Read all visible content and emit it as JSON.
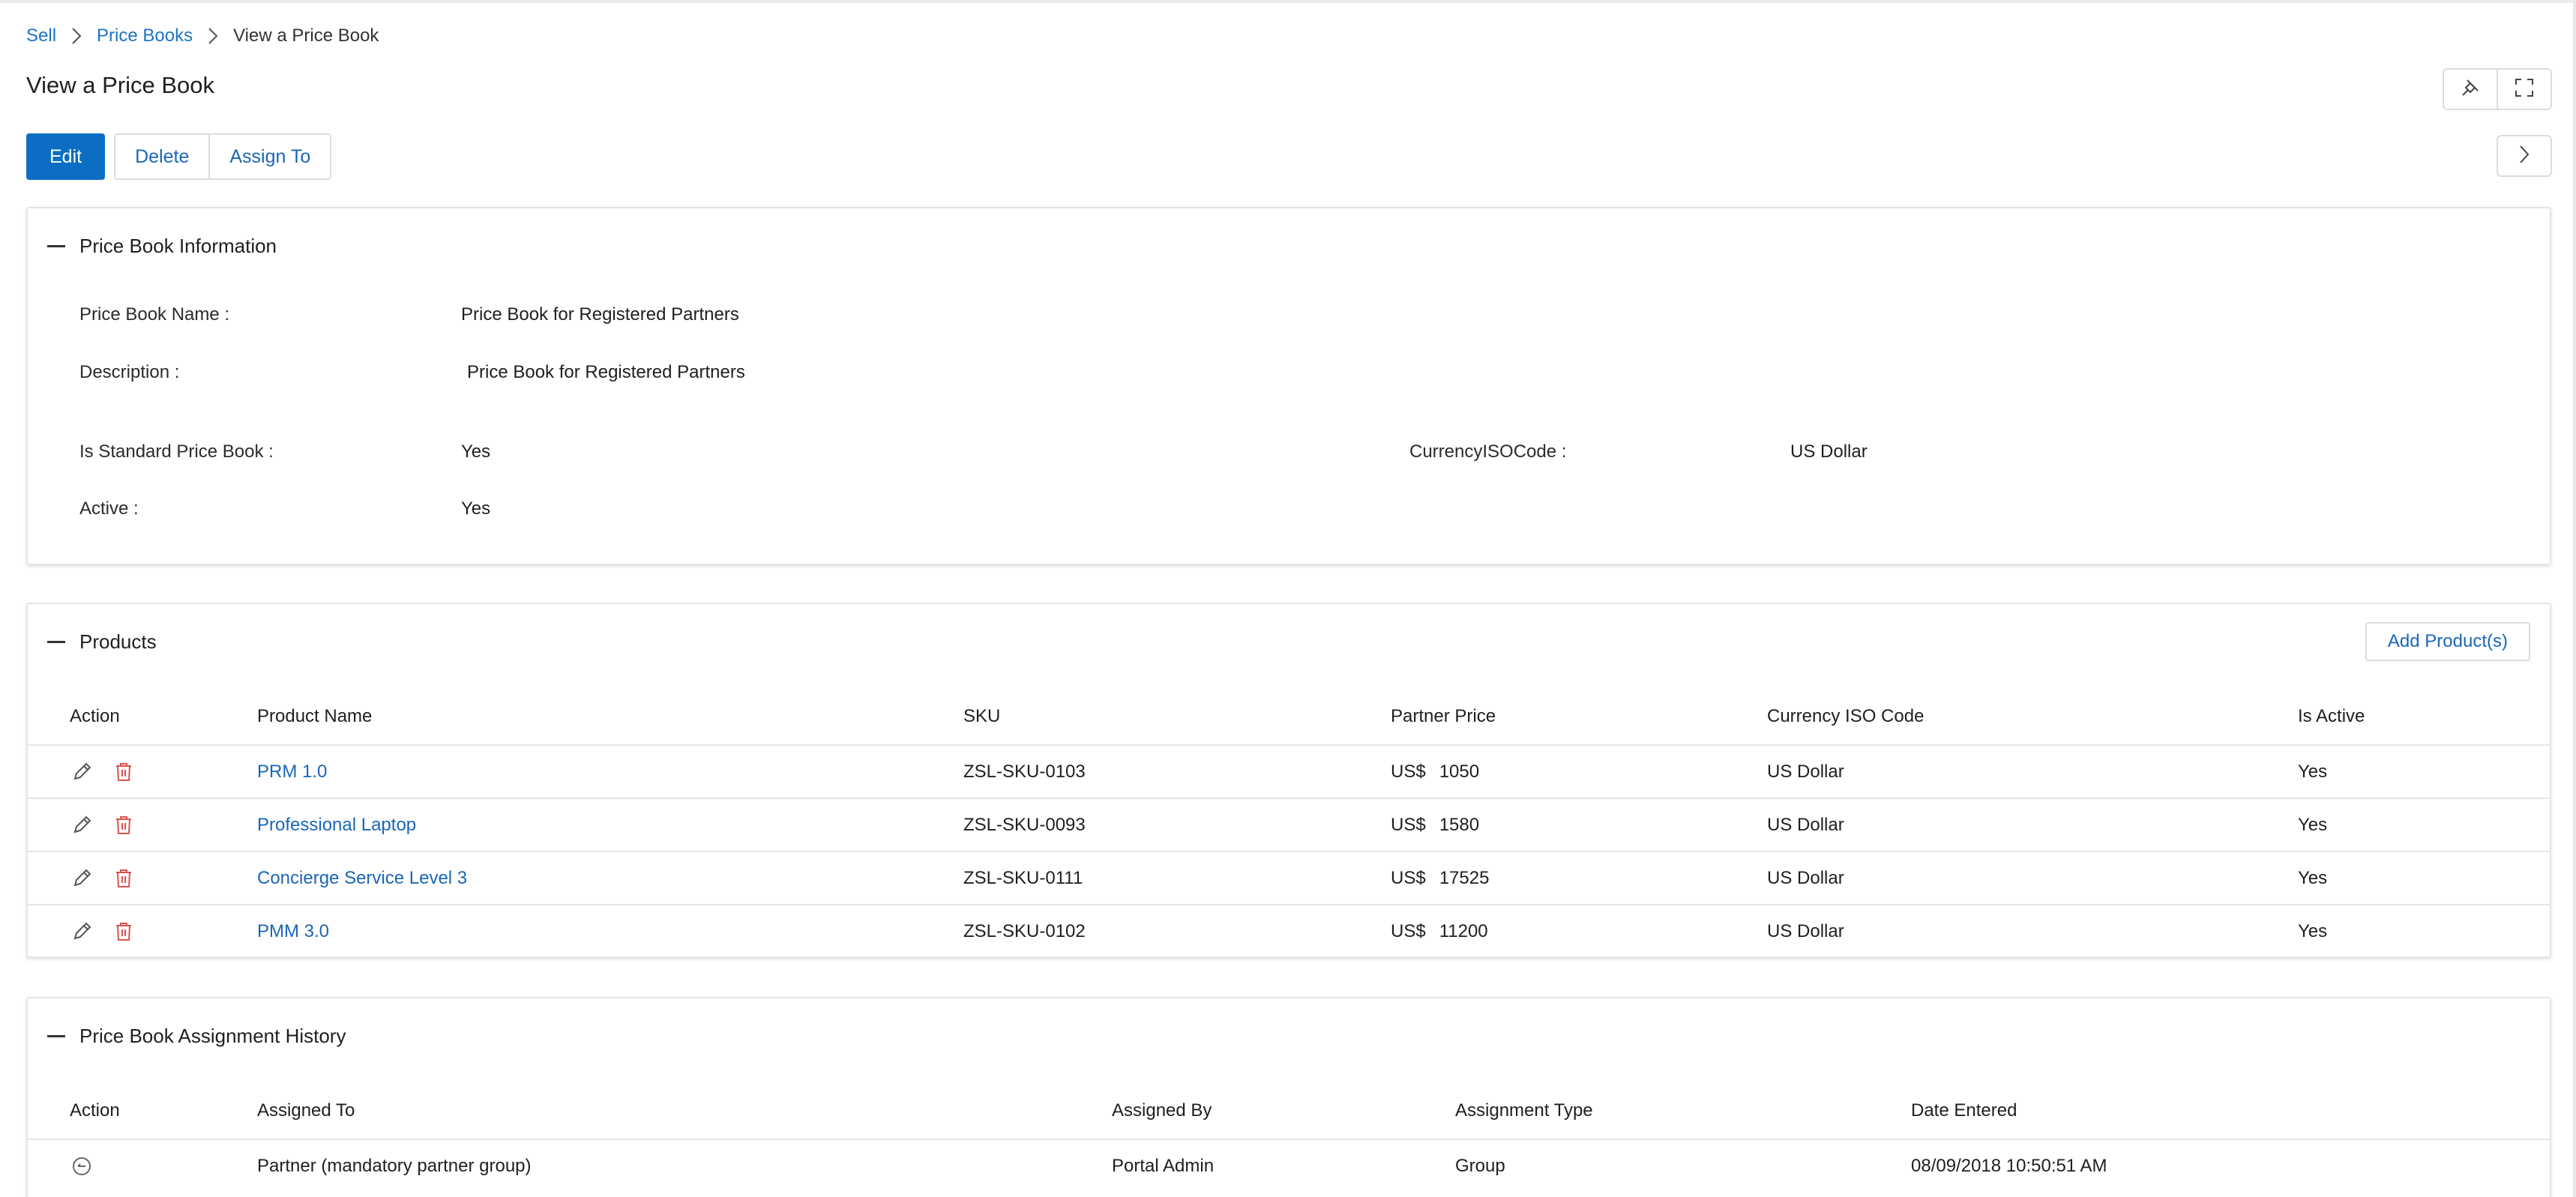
{
  "breadcrumb": {
    "items": [
      {
        "label": "Sell"
      },
      {
        "label": "Price Books"
      },
      {
        "label": "View a Price Book"
      }
    ]
  },
  "page": {
    "title": "View a Price Book"
  },
  "toolbar": {
    "edit_label": "Edit",
    "delete_label": "Delete",
    "assign_label": "Assign To"
  },
  "info_panel": {
    "title": "Price Book Information",
    "fields": {
      "name": {
        "label": "Price Book Name :",
        "value": "Price Book for Registered Partners"
      },
      "description": {
        "label": "Description :",
        "value": "Price Book for Registered Partners"
      },
      "is_standard": {
        "label": "Is Standard Price Book :",
        "value": "Yes"
      },
      "currency": {
        "label": "CurrencyISOCode :",
        "value": "US Dollar"
      },
      "active": {
        "label": "Active :",
        "value": "Yes"
      }
    }
  },
  "products_panel": {
    "title": "Products",
    "add_label": "Add Product(s)",
    "columns": [
      "Action",
      "Product Name",
      "SKU",
      "Partner Price",
      "Currency ISO Code",
      "Is Active"
    ],
    "rows": [
      {
        "name": "PRM 1.0",
        "sku": "ZSL-SKU-0103",
        "currency_prefix": "US$",
        "price": "1050",
        "currency": "US Dollar",
        "active": "Yes"
      },
      {
        "name": "Professional Laptop",
        "sku": "ZSL-SKU-0093",
        "currency_prefix": "US$",
        "price": "1580",
        "currency": "US Dollar",
        "active": "Yes"
      },
      {
        "name": "Concierge Service Level 3",
        "sku": "ZSL-SKU-0111",
        "currency_prefix": "US$",
        "price": "17525",
        "currency": "US Dollar",
        "active": "Yes"
      },
      {
        "name": "PMM 3.0",
        "sku": "ZSL-SKU-0102",
        "currency_prefix": "US$",
        "price": "11200",
        "currency": "US Dollar",
        "active": "Yes"
      }
    ]
  },
  "history_panel": {
    "title": "Price Book Assignment History",
    "columns": [
      "Action",
      "Assigned To",
      "Assigned By",
      "Assignment Type",
      "Date Entered"
    ],
    "rows": [
      {
        "assigned_to": "Partner (mandatory partner group)",
        "assigned_by": "Portal Admin",
        "type": "Group",
        "date": "08/09/2018 10:50:51 AM"
      }
    ]
  },
  "icons": {
    "pin": "pin-icon",
    "expand": "expand-icon",
    "next": "chevron-right-icon",
    "edit": "pencil-icon",
    "delete": "trash-icon",
    "unassign": "unassign-icon"
  },
  "colors": {
    "primary": "#0b6ec2",
    "link": "#1a66b8",
    "delete_icon": "#d9534f"
  }
}
